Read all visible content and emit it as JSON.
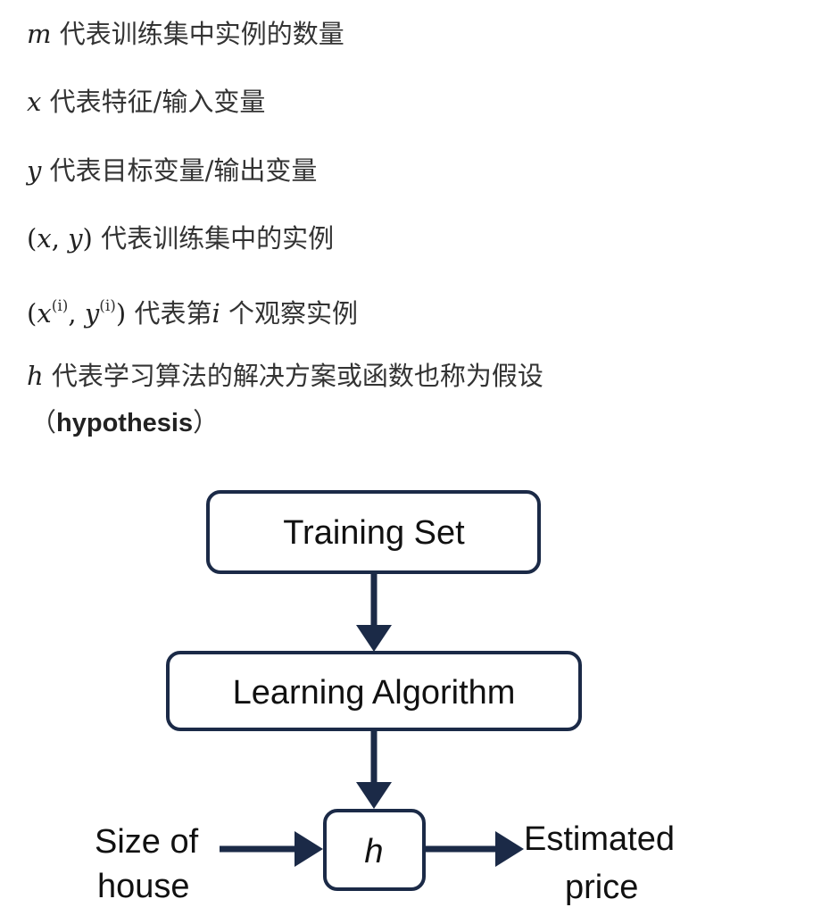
{
  "definitions": [
    {
      "symbol": "m",
      "text": "代表训练集中实例的数量"
    },
    {
      "symbol": "x",
      "text": "代表特征/输入变量"
    },
    {
      "symbol": "y",
      "text": "代表目标变量/输出变量"
    },
    {
      "symbol_open": "(",
      "symbol_x": "x",
      "symbol_sep": ", ",
      "symbol_y": "y",
      "symbol_close": ")",
      "text": "代表训练集中的实例"
    },
    {
      "symbol_open": "(",
      "symbol_x": "x",
      "sup": "(i)",
      "symbol_sep": ", ",
      "symbol_y": "y",
      "symbol_close": ")",
      "text": "代表第",
      "inline_var": "i",
      "text_after": "个观察实例"
    },
    {
      "symbol": "h",
      "text": "代表学习算法的解决方案或函数也称为假设",
      "paren_open": "（",
      "bold_term": "hypothesis",
      "paren_close": "）"
    }
  ],
  "diagram": {
    "training_set": "Training Set",
    "learning_algorithm": "Learning Algorithm",
    "hypothesis": "h",
    "input_line1": "Size of",
    "input_line2": "house",
    "output_line1": "Estimated",
    "output_line2": "price",
    "stroke_color": "#1b2a47",
    "text_color": "#111111"
  }
}
